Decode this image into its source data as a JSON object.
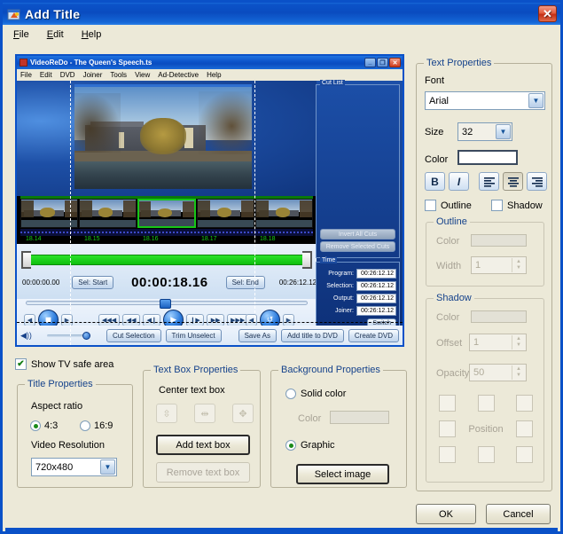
{
  "window": {
    "title": "Add Title",
    "close_label": "✕",
    "icon": "add-title-icon"
  },
  "menubar": {
    "items": [
      {
        "label": "File",
        "accel": "F"
      },
      {
        "label": "Edit",
        "accel": "E"
      },
      {
        "label": "Help",
        "accel": "H"
      }
    ]
  },
  "preview": {
    "app_title": "VideoReDo - The Queen's Speech.ts",
    "minimize": "_",
    "maximize": "❐",
    "close": "✕",
    "menu": [
      "File",
      "Edit",
      "DVD",
      "Joiner",
      "Tools",
      "View",
      "Ad-Detective",
      "Help"
    ],
    "filmstrip_times": [
      "18.14",
      "18.15",
      "18.16",
      "18.17",
      "18.18"
    ],
    "timeline": {
      "start": "00:00:00.00",
      "set_start": "Sel: Start",
      "current": "00:00:18.16",
      "set_end": "Sel: End",
      "end": "00:26:12.12"
    },
    "transport": {
      "stop": "◼",
      "rew3": "◀◀◀",
      "rew2": "◀◀",
      "rew1": "◀❙",
      "play": "▶",
      "fwd1": "❙▶",
      "fwd2": "▶▶",
      "fwd3": "▶▶▶",
      "loop": "↺",
      "step_back": "◀",
      "step_fwd": "▶"
    },
    "cutlist": {
      "legend": "Cut List",
      "invert": "Invert All Cuts",
      "remove": "Remove Selected Cuts"
    },
    "timepanel": {
      "legend": "Time",
      "rows": [
        {
          "label": "Program:",
          "value": "00:26:12.12"
        },
        {
          "label": "Selection:",
          "value": "00:26:12.12"
        },
        {
          "label": "Output:",
          "value": "00:26:12.12"
        },
        {
          "label": "Joiner:",
          "value": "00:26:12.12"
        }
      ],
      "switch": "Switch"
    },
    "bottom_buttons": [
      "Cut Selection",
      "Trim Unselect",
      "Save As",
      "Add title to DVD",
      "Create DVD"
    ]
  },
  "tv_safe": {
    "label": "Show TV safe area",
    "checked": true,
    "check_glyph": "✔"
  },
  "title_properties": {
    "legend": "Title Properties",
    "aspect_label": "Aspect ratio",
    "aspect_options": [
      {
        "label": "4:3",
        "selected": true
      },
      {
        "label": "16:9",
        "selected": false
      }
    ],
    "resolution_label": "Video Resolution",
    "resolution_value": "720x480"
  },
  "textbox_properties": {
    "legend": "Text Box Properties",
    "center_label": "Center text box",
    "center_buttons": [
      "center-vertical-icon",
      "center-horizontal-icon",
      "center-both-icon"
    ],
    "add_button": "Add text box",
    "remove_button": "Remove text box"
  },
  "background_properties": {
    "legend": "Background Properties",
    "solid_label": "Solid color",
    "solid_selected": false,
    "color_label": "Color",
    "graphic_label": "Graphic",
    "graphic_selected": true,
    "select_image_button": "Select image"
  },
  "text_properties": {
    "legend": "Text Properties",
    "font_label": "Font",
    "font_value": "Arial",
    "size_label": "Size",
    "size_value": "32",
    "color_label": "Color",
    "color_value": "#ffffff",
    "style_buttons": [
      {
        "name": "bold-icon",
        "glyph": "B",
        "pressed": false
      },
      {
        "name": "italic-icon",
        "glyph": "𝙄",
        "pressed": false
      }
    ],
    "align_buttons": [
      {
        "name": "align-left-icon",
        "glyph": "≡",
        "pressed": false
      },
      {
        "name": "align-center-icon",
        "glyph": "≡",
        "pressed": true
      },
      {
        "name": "align-right-icon",
        "glyph": "≡",
        "pressed": false
      }
    ],
    "outline_checkbox": {
      "label": "Outline",
      "checked": false
    },
    "shadow_checkbox": {
      "label": "Shadow",
      "checked": false
    },
    "outline_group": {
      "legend": "Outline",
      "color_label": "Color",
      "width_label": "Width",
      "width_value": "1"
    },
    "shadow_group": {
      "legend": "Shadow",
      "color_label": "Color",
      "offset_label": "Offset",
      "offset_value": "1",
      "opacity_label": "Opacity",
      "opacity_value": "50",
      "position_label": "Position"
    }
  },
  "dialog_buttons": {
    "ok": "OK",
    "cancel": "Cancel"
  },
  "colors": {
    "title_blue": "#0b52c8",
    "group_legend": "#15428b",
    "face": "#ece9d8",
    "timeline_green": "#1bc91b"
  }
}
